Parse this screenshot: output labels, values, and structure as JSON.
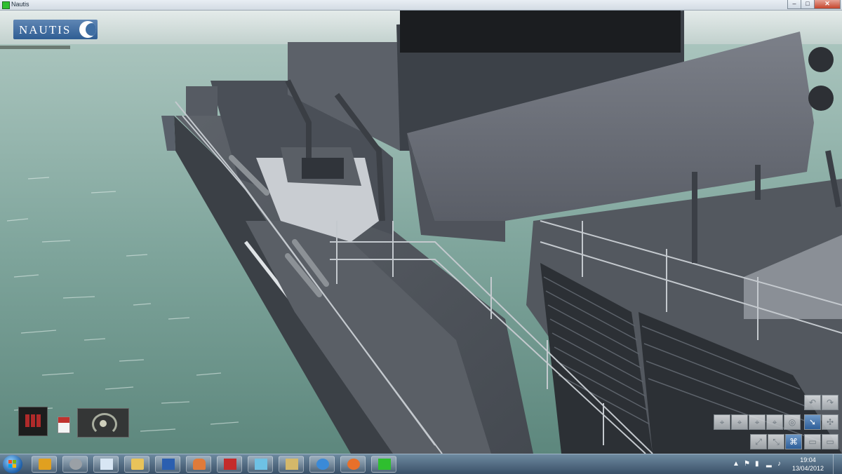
{
  "window": {
    "title": "Nautis",
    "controls": {
      "minimize": "–",
      "maximize": "□",
      "close": "✕"
    }
  },
  "logo": {
    "text": "NAUTIS"
  },
  "hud": [
    {
      "icon": "engine-telegraph-icon"
    },
    {
      "icon": "signal-flag-icon"
    },
    {
      "icon": "helm-wheel-icon"
    }
  ],
  "view_toolbar": {
    "row1": [
      "undo-icon",
      "redo-icon"
    ],
    "row2": [
      "camera-icon",
      "camera-icon",
      "camera-icon",
      "camera-icon",
      "target-icon",
      "pointer-icon",
      "compass-icon"
    ],
    "row3": [
      "zoom-icon",
      "zoom-icon",
      "binoculars-icon",
      "fullscreen-icon",
      "fullscreen-icon"
    ],
    "active": [
      "pointer-icon",
      "binoculars-icon"
    ]
  },
  "taskbar": {
    "apps": [
      {
        "name": "taskbar-app-1",
        "icon": "certificate-icon",
        "color": "#e0a020"
      },
      {
        "name": "taskbar-app-2",
        "icon": "settings-gear-icon",
        "color": "#9aa0a6"
      },
      {
        "name": "taskbar-app-3",
        "icon": "notepad-icon",
        "color": "#d8e6f4"
      },
      {
        "name": "taskbar-app-4",
        "icon": "folder-icon",
        "color": "#e8c35a"
      },
      {
        "name": "taskbar-app-5",
        "icon": "word-document-icon",
        "color": "#2b5fb0"
      },
      {
        "name": "taskbar-app-6",
        "icon": "ship-icon",
        "color": "#e07b3a"
      },
      {
        "name": "taskbar-app-7",
        "icon": "pdf-icon",
        "color": "#c42b2b"
      },
      {
        "name": "taskbar-app-8",
        "icon": "notebook-icon",
        "color": "#6ec1e4"
      },
      {
        "name": "taskbar-app-9",
        "icon": "presentation-icon",
        "color": "#d4b86a"
      },
      {
        "name": "taskbar-app-10",
        "icon": "messenger-icon",
        "color": "#3a8ad8"
      },
      {
        "name": "taskbar-app-11",
        "icon": "firefox-icon",
        "color": "#e8702a"
      },
      {
        "name": "taskbar-app-12",
        "icon": "nautis-play-icon",
        "color": "#2fbf2f"
      }
    ],
    "tray": {
      "show_hidden": "▲",
      "icons": [
        "flag-icon",
        "power-icon",
        "network-icon",
        "volume-icon"
      ],
      "time": "19:04",
      "date": "13/04/2012"
    }
  }
}
